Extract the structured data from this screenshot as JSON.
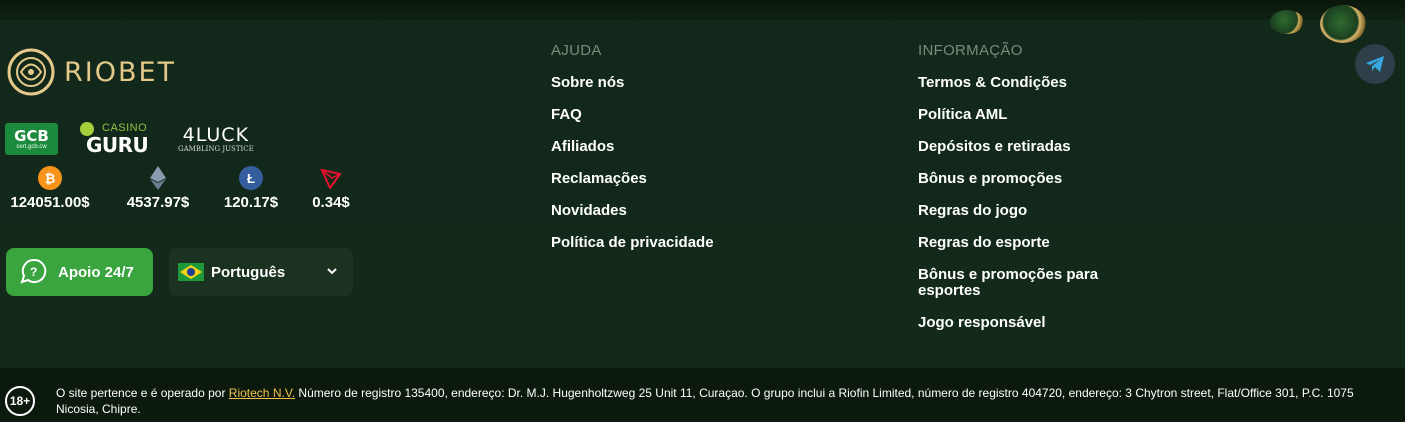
{
  "brand": {
    "name": "RIOBET",
    "gold": "#e4c98a"
  },
  "badges": {
    "gcb": {
      "main": "GCB",
      "sub": "cert.gcb.cw"
    },
    "casino_guru": {
      "top": "CASINO",
      "main": "GURU"
    },
    "luck": {
      "main": "4LUCK",
      "sub": "GAMBLING JUSTICE"
    }
  },
  "crypto": [
    {
      "icon": "bitcoin-icon",
      "symbol": "₿",
      "color": "#f7931a",
      "value": "124051.00$"
    },
    {
      "icon": "ethereum-icon",
      "symbol": "◆",
      "color": "#6b7d92",
      "value": "4537.97$"
    },
    {
      "icon": "litecoin-icon",
      "symbol": "Ł",
      "color": "#345d9d",
      "value": "120.17$"
    },
    {
      "icon": "tron-icon",
      "symbol": "▽",
      "color": "#e8112d",
      "value": "0.34$"
    }
  ],
  "support": {
    "label": "Apoio 24/7",
    "color": "#3aa43f"
  },
  "language": {
    "selected": "Português"
  },
  "help": {
    "title": "AJUDA",
    "links": [
      "Sobre nós",
      "FAQ",
      "Afiliados",
      "Reclamações",
      "Novidades",
      "Política de privacidade"
    ]
  },
  "info": {
    "title": "INFORMAÇÃO",
    "links": [
      "Termos & Condições",
      "Política AML",
      "Depósitos e retiradas",
      "Bônus e promoções",
      "Regras do jogo",
      "Regras do esporte",
      "Bônus e promoções para esportes",
      "Jogo responsável"
    ]
  },
  "legal": {
    "age": "18+",
    "prefix": "O site pertence e é operado por",
    "company_link": "Riotech N.V.",
    "text": "Número de registro 135400, endereço: Dr. M.J. Hugenholtzweg 25 Unit 11, Curaçao. O grupo inclui a Riofin Limited, número de registro 404720, endereço: 3 Chytron street, Flat/Office 301, P.C. 1075 Nicosia, Chipre."
  }
}
